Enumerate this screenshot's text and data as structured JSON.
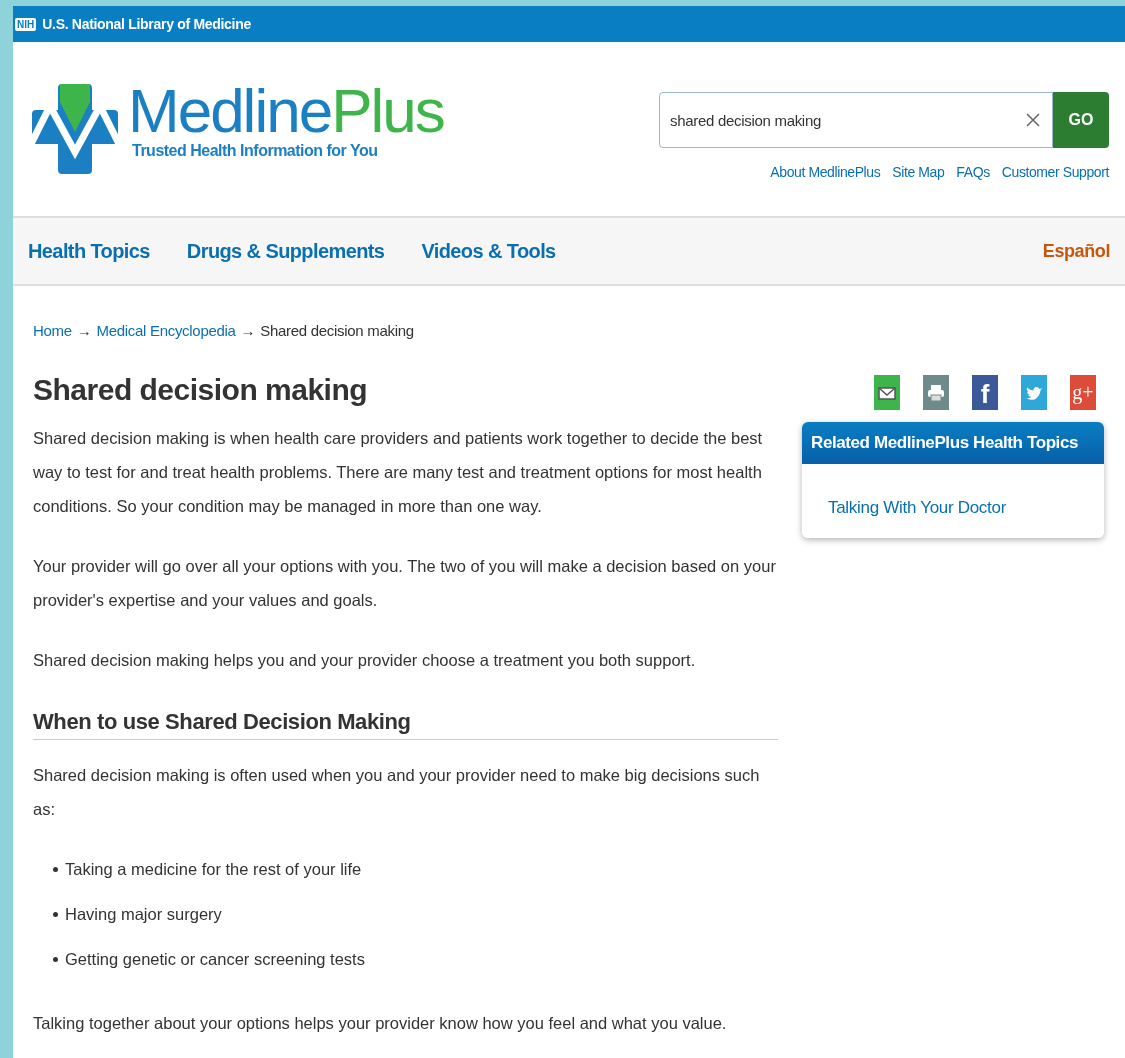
{
  "top_bar": {
    "badge": "NIH",
    "title": "U.S. National Library of Medicine"
  },
  "logo": {
    "name_first": "Medline",
    "name_second": "Plus",
    "tagline": "Trusted Health Information for You"
  },
  "search": {
    "value": "shared decision making",
    "button": "GO"
  },
  "utility_links": [
    "About MedlinePlus",
    "Site Map",
    "FAQs",
    "Customer Support"
  ],
  "nav": {
    "items": [
      {
        "label": "Health Topics"
      },
      {
        "label": "Drugs & Supplements"
      },
      {
        "label": "Videos & Tools"
      }
    ],
    "language_link": "Español"
  },
  "breadcrumb": {
    "separator": "→",
    "items": [
      {
        "label": "Home",
        "kind": "link"
      },
      {
        "label": "Medical Encyclopedia",
        "kind": "link"
      },
      {
        "label": "Shared decision making",
        "kind": "current"
      }
    ]
  },
  "share_icons": [
    {
      "kind": "email",
      "color": "#3db54a"
    },
    {
      "kind": "print",
      "color": "#6f8a8a"
    },
    {
      "kind": "facebook",
      "color": "#3b5998",
      "glyph": "f"
    },
    {
      "kind": "twitter",
      "color": "#2ea8d8"
    },
    {
      "kind": "google-plus",
      "color": "#dd4b39",
      "glyph": "g+"
    }
  ],
  "article": {
    "title": "Shared decision making",
    "paragraphs": [
      "Shared decision making is when health care providers and patients work together to decide the best way to test for and treat health problems. There are many test and treatment options for most health conditions. So your condition may be managed in more than one way.",
      "Your provider will go over all your options with you. The two of you will make a decision based on your provider's expertise and your values and goals.",
      "Shared decision making helps you and your provider choose a treatment you both support."
    ],
    "section": {
      "heading": "When to use Shared Decision Making",
      "intro": "Shared decision making is often used when you and your provider need to make big decisions such as:",
      "bullets": [
        "Taking a medicine for the rest of your life",
        "Having major surgery",
        "Getting genetic or cancer screening tests"
      ],
      "closing": "Talking together about your options helps your provider know how you feel and what you value."
    }
  },
  "related": {
    "title": "Related MedlinePlus Health Topics",
    "links": [
      "Talking With Your Doctor"
    ]
  }
}
